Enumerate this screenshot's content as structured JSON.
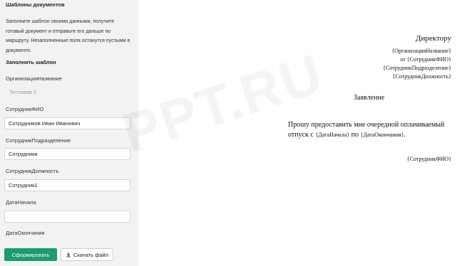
{
  "panel": {
    "title": "Шаблоны документов",
    "description": "Заполните шаблон своими данными, получите готовый документ и отправьте его дальше по маршруту. Незаполненные поля останутся пустыми в документе.",
    "section_title": "Заполнить шаблон",
    "fields": [
      {
        "label": "ОрганизацияНазвание",
        "value": "Тестовая 2"
      },
      {
        "label": "СотрудникФИО",
        "value": "Сотрудников Иван Иванович"
      },
      {
        "label": "СотрудникПодразделение",
        "value": "Сотрудники"
      },
      {
        "label": "СотрудникДолжность",
        "value": "Сотрудник1"
      },
      {
        "label": "ДатаНачала",
        "value": ""
      },
      {
        "label": "ДатаОкончания",
        "value": ""
      }
    ],
    "generate_button": "Сформировать",
    "download_button": "Скачать файл",
    "download_icon": "download-icon"
  },
  "document": {
    "addressee": "Директору",
    "org": "{ОрганизацияНазвание}",
    "from_prefix": "от ",
    "from_name": "{СотрудникФИО}",
    "dept": "{СотрудникПодразделение}",
    "position": "{СотрудникДолжность}",
    "heading": "Заявление",
    "body_start": "Прошу предоставить мне очередной оплачиваемый отпуск с ",
    "date_start": "{ДатаНачала}",
    "body_mid": " по ",
    "date_end": "{ДатаОкончания}",
    "body_end": ".",
    "signature": "{СотрудникФИО}"
  },
  "watermark": "PPT.RU",
  "colors": {
    "accent": "#1b9c6e",
    "sidebar_bg": "#f2f2f2"
  }
}
